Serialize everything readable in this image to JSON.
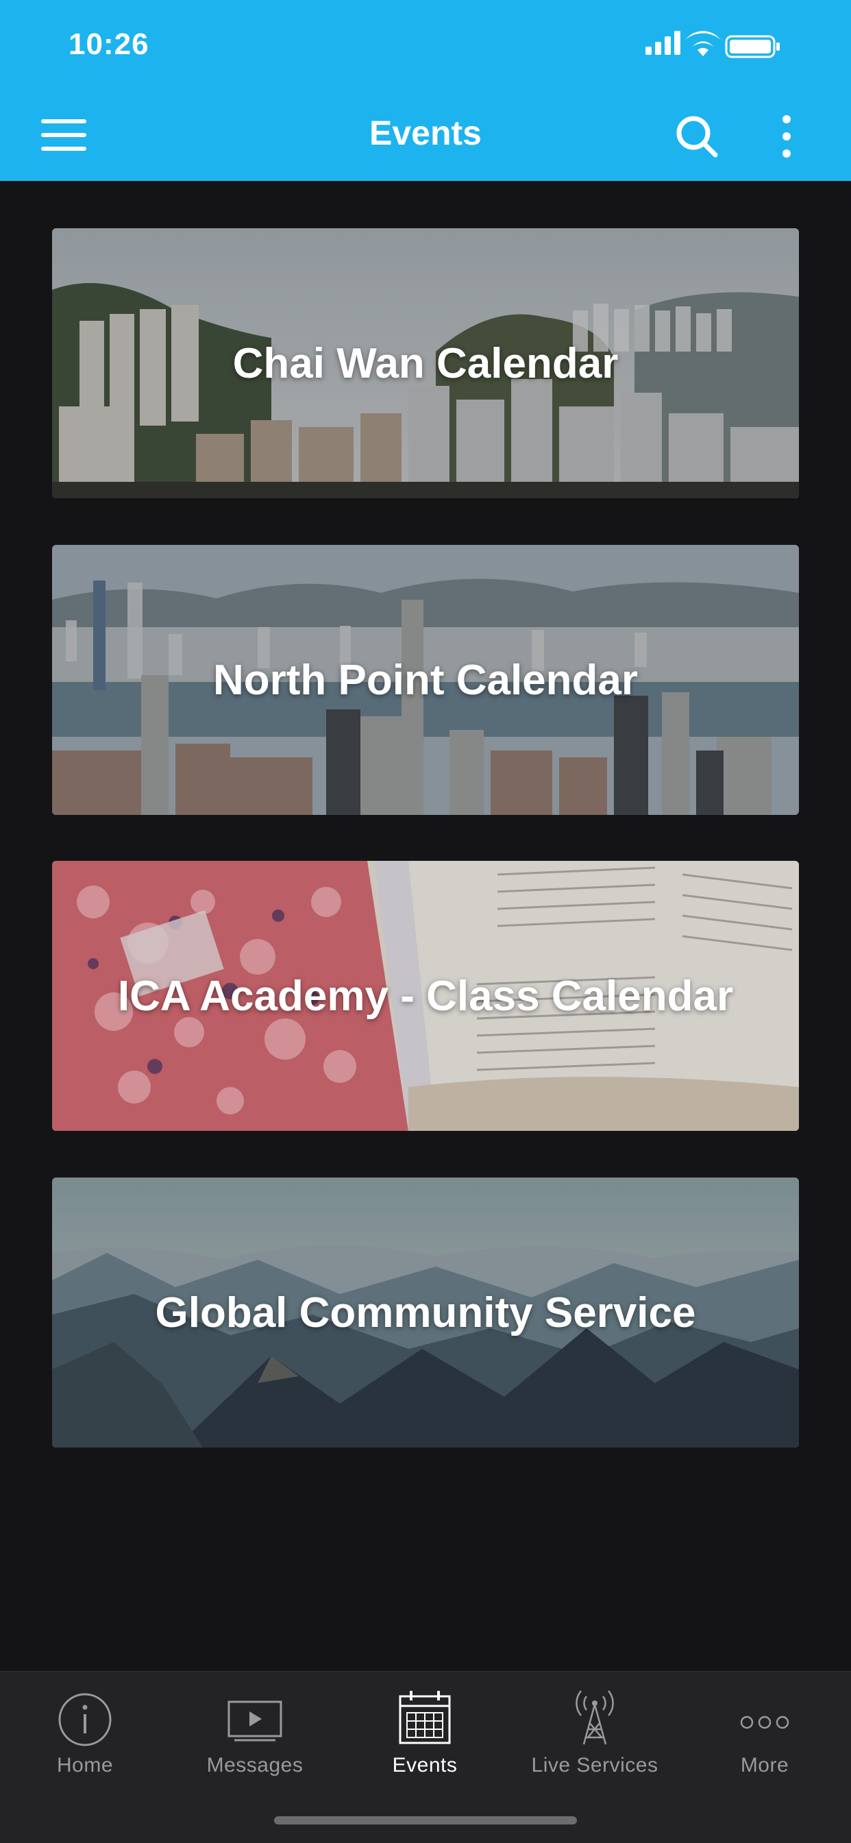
{
  "status_bar": {
    "time": "10:26"
  },
  "header": {
    "title": "Events"
  },
  "cards": [
    {
      "title": "Chai Wan Calendar"
    },
    {
      "title": "North Point Calendar"
    },
    {
      "title": "ICA Academy - Class Calendar"
    },
    {
      "title": "Global Community Service"
    }
  ],
  "tabs": [
    {
      "label": "Home",
      "icon": "info-icon"
    },
    {
      "label": "Messages",
      "icon": "video-icon"
    },
    {
      "label": "Events",
      "icon": "calendar-icon"
    },
    {
      "label": "Live Services",
      "icon": "broadcast-tower-icon"
    },
    {
      "label": "More",
      "icon": "more-dots-icon"
    }
  ],
  "colors": {
    "header": "#1db3ef",
    "background": "#141416",
    "tabbar": "#232325",
    "active_tab": "#ffffff",
    "inactive_tab": "#9a9a9e"
  }
}
